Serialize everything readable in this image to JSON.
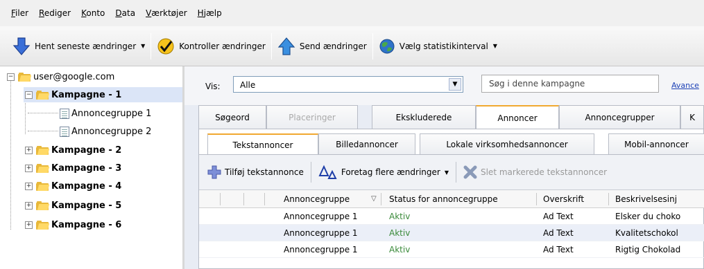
{
  "menu": [
    "Filer",
    "Rediger",
    "Konto",
    "Data",
    "Værktøjer",
    "Hjælp"
  ],
  "toolbar": {
    "get_changes": "Hent seneste ændringer",
    "check_changes": "Kontroller ændringer",
    "send_changes": "Send ændringer",
    "stats_interval": "Vælg statistikinterval"
  },
  "tree": {
    "account": "user@google.com",
    "campaigns": [
      "Kampagne - 1",
      "Kampagne - 2",
      "Kampagne - 3",
      "Kampagne - 4",
      "Kampagne - 5",
      "Kampagne - 6"
    ],
    "adgroups": [
      "Annoncegruppe 1",
      "Annoncegruppe 2"
    ]
  },
  "filter": {
    "vis_label": "Vis:",
    "vis_value": "Alle",
    "search_placeholder": "Søg i denne kampagne",
    "advanced": "Avance"
  },
  "tabs": [
    "Søgeord",
    "Placeringer",
    "Ekskluderede",
    "Annoncer",
    "Annoncegrupper",
    "K"
  ],
  "subtabs": [
    "Tekstannoncer",
    "Billedannoncer",
    "Lokale virksomhedsannoncer",
    "Mobil-annoncer"
  ],
  "actions": {
    "add": "Tilføj tekstannonce",
    "multi": "Foretag flere ændringer",
    "delete": "Slet markerede tekstannoncer"
  },
  "table": {
    "columns": [
      "Annoncegruppe",
      "Status for annoncegruppe",
      "Overskrift",
      "Beskrivelsesinj"
    ],
    "rows": [
      [
        "Annoncegruppe 1",
        "Aktiv",
        "Ad Text",
        "Elsker du choko"
      ],
      [
        "Annoncegruppe 1",
        "Aktiv",
        "Ad Text",
        "Kvalitetschokol"
      ],
      [
        "Annoncegruppe 1",
        "Aktiv",
        "Ad Text",
        "Rigtig Chokolad"
      ]
    ]
  },
  "colors": {
    "accent_tab": "#f0a830",
    "selected": "#dbe5f7",
    "link": "#1a3fb5",
    "status_active": "#3a8a3a"
  }
}
